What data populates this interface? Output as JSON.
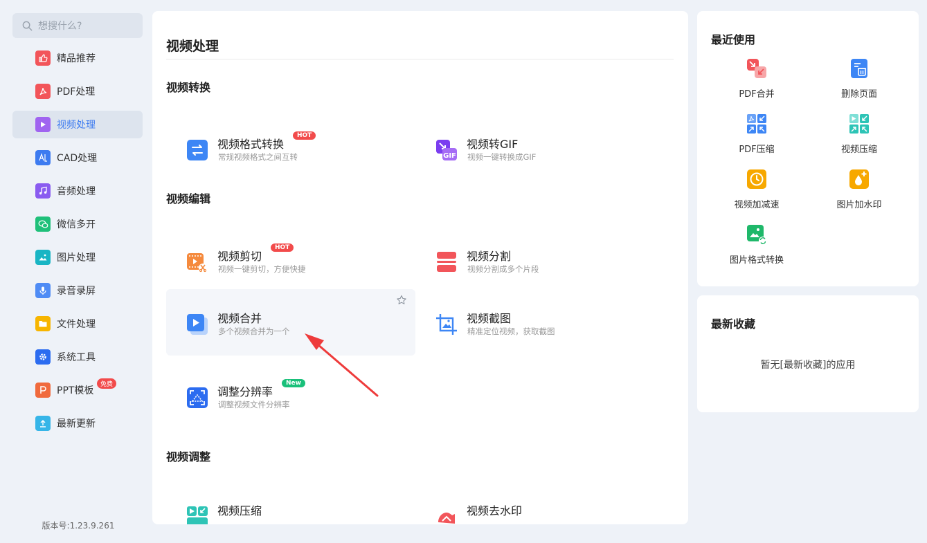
{
  "search": {
    "placeholder": "想搜什么?"
  },
  "sidebar": {
    "items": [
      {
        "label": "精品推荐",
        "icon": "thumbs-up-icon",
        "color": "#f2555a"
      },
      {
        "label": "PDF处理",
        "icon": "pdf-icon",
        "color": "#f2555a"
      },
      {
        "label": "视频处理",
        "icon": "video-play-icon",
        "color": "#a064f0",
        "active": true
      },
      {
        "label": "CAD处理",
        "icon": "cad-icon",
        "color": "#3d7bf0"
      },
      {
        "label": "音频处理",
        "icon": "music-icon",
        "color": "#8a5cf0"
      },
      {
        "label": "微信多开",
        "icon": "wechat-icon",
        "color": "#1fc07a"
      },
      {
        "label": "图片处理",
        "icon": "image-icon",
        "color": "#19b5c4"
      },
      {
        "label": "录音录屏",
        "icon": "microphone-icon",
        "color": "#4f8cf5"
      },
      {
        "label": "文件处理",
        "icon": "folder-icon",
        "color": "#f7b500"
      },
      {
        "label": "系统工具",
        "icon": "gear-icon",
        "color": "#2c6cf0"
      },
      {
        "label": "PPT模板",
        "icon": "ppt-icon",
        "color": "#f06a3d",
        "badge": "免费"
      },
      {
        "label": "最新更新",
        "icon": "upload-icon",
        "color": "#36b5e8"
      }
    ],
    "version": "版本号:1.23.9.261"
  },
  "main": {
    "title": "视频处理",
    "sections": [
      {
        "title": "视频转换"
      },
      {
        "title": "视频编辑"
      },
      {
        "title": "视频调整"
      }
    ],
    "tools": [
      {
        "name": "视频格式转换",
        "desc": "常规视频格式之间互转",
        "tag": "HOT",
        "icon": "convert-icon"
      },
      {
        "name": "视频转GIF",
        "desc": "视频一键转换成GIF",
        "icon": "gif-icon",
        "gif_label": "GIF"
      },
      {
        "name": "视频剪切",
        "desc": "视频一键剪切，方便快捷",
        "tag": "HOT",
        "icon": "video-cut-icon"
      },
      {
        "name": "视频分割",
        "desc": "视频分割成多个片段",
        "icon": "video-split-icon"
      },
      {
        "name": "视频合并",
        "desc": "多个视频合并为一个",
        "icon": "video-merge-icon"
      },
      {
        "name": "视频截图",
        "desc": "精准定位视频，获取截图",
        "icon": "crop-icon"
      },
      {
        "name": "调整分辨率",
        "desc": "调整视频文件分辨率",
        "tag": "New",
        "icon": "resolution-icon"
      },
      {
        "name": "视频压缩",
        "desc": "",
        "icon": "video-compress-icon"
      },
      {
        "name": "视频去水印",
        "desc": "",
        "icon": "watermark-remove-icon"
      }
    ]
  },
  "recent": {
    "title": "最近使用",
    "items": [
      {
        "label": "PDF合并",
        "icon": "pdf-merge-icon"
      },
      {
        "label": "删除页面",
        "icon": "delete-page-icon"
      },
      {
        "label": "PDF压缩",
        "icon": "pdf-compress-icon"
      },
      {
        "label": "视频压缩",
        "icon": "video-compress-icon"
      },
      {
        "label": "视频加减速",
        "icon": "speed-icon"
      },
      {
        "label": "图片加水印",
        "icon": "image-watermark-icon"
      },
      {
        "label": "图片格式转换",
        "icon": "image-convert-icon"
      }
    ]
  },
  "favorites": {
    "title": "最新收藏",
    "empty_text": "暂无[最新收藏]的应用"
  }
}
